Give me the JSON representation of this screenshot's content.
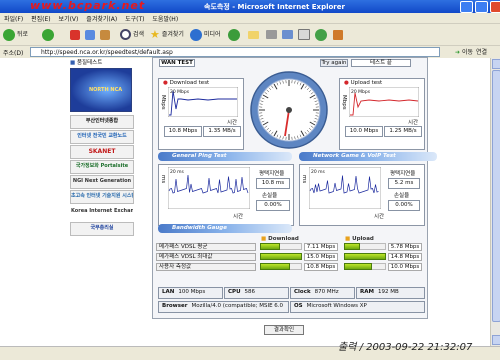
{
  "window": {
    "title": "속도측정 - Microsoft Internet Explorer",
    "watermark": "www.bcpark.net"
  },
  "menu": [
    "파일(F)",
    "편집(E)",
    "보기(V)",
    "즐겨찾기(A)",
    "도구(T)",
    "도움말(H)"
  ],
  "toolbar": {
    "back": "뒤로",
    "search": "검색",
    "favorites": "즐겨찾기",
    "media": "미디어"
  },
  "address": {
    "label": "주소(D)",
    "url": "http://speed.nca.or.kr/speedtest/default.asp",
    "go": "이동",
    "links": "연결"
  },
  "sidebar": {
    "header": "품질테스트",
    "banner_text": "NORTH NCA",
    "items": [
      "부산인터넷종합",
      "인터넷 전국민 교환노드",
      "SKANET",
      "국가정보화 Portalsite",
      "NGI Next Generation",
      "초고속 인터넷 기술지원 시스템",
      "Korea Internet Exchange",
      "국무총리실"
    ]
  },
  "panel": {
    "tab": "WAN TEST",
    "try_again": "Try again",
    "test_state": "테스트 끝",
    "download": {
      "title": "Download test",
      "y_axis": "Mbps",
      "scale_max": "20 Mbps",
      "x_axis": "시간",
      "readings": [
        "10.8 Mbps",
        "1.35 MB/s"
      ]
    },
    "upload": {
      "title": "Upload test",
      "y_axis": "Mbps",
      "scale_max": "20 Mbps",
      "x_axis": "시간",
      "readings": [
        "10.0 Mbps",
        "1.25 MB/s"
      ]
    },
    "ping_head": "General Ping Test",
    "voip_head": "Network Game & VoIP Test",
    "ping": {
      "y_axis": "ms",
      "scale_max": "20 ms",
      "x_axis": "시간",
      "avg_label": "평택지연율",
      "avg_value": "10.8 ms",
      "loss_label": "손실율",
      "loss_value": "0.00%"
    },
    "voip": {
      "y_axis": "ms",
      "scale_max": "20 ms",
      "x_axis": "시간",
      "avg_label": "평택지연율",
      "avg_value": "5.2 ms",
      "loss_label": "손실율",
      "loss_value": "0.00%"
    },
    "bandwidth_head": "Bandwidth Gauge",
    "bw_download": "Download",
    "bw_upload": "Upload",
    "bw_rows": [
      {
        "label": "메가패스 VDSL 평균",
        "down": "7.11 Mbps",
        "up": "5.78 Mbps",
        "down_fill": 0.47,
        "up_fill": 0.39
      },
      {
        "label": "메가패스 VDSL 최대값",
        "down": "15.0 Mbps",
        "up": "14.8 Mbps",
        "down_fill": 1.0,
        "up_fill": 0.99
      },
      {
        "label": "사용자 측정값",
        "down": "10.8 Mbps",
        "up": "10.0 Mbps",
        "down_fill": 0.72,
        "up_fill": 0.67
      }
    ],
    "info": {
      "lan_label": "LAN",
      "lan": "100 Mbps",
      "cpu_label": "CPU",
      "cpu": "586",
      "clock_label": "Clock",
      "clock": "870 MHz",
      "ram_label": "RAM",
      "ram": "192 MB",
      "browser_label": "Browser",
      "browser": "Mozilla/4.0 (compatible; MSIE 6.0",
      "os_label": "OS",
      "os": "Microsoft Windows XP"
    },
    "confirm": "결과확인"
  },
  "stamp": "출력 / 2003-09-22 21:32:07",
  "colors": {
    "titlebar": "#1a56d6",
    "accent": "#4a7ac9",
    "download_line": "#1c2a9e",
    "upload_line": "#d4262b",
    "gauge_bar": "#8ac71c",
    "stamp": "#222222"
  }
}
